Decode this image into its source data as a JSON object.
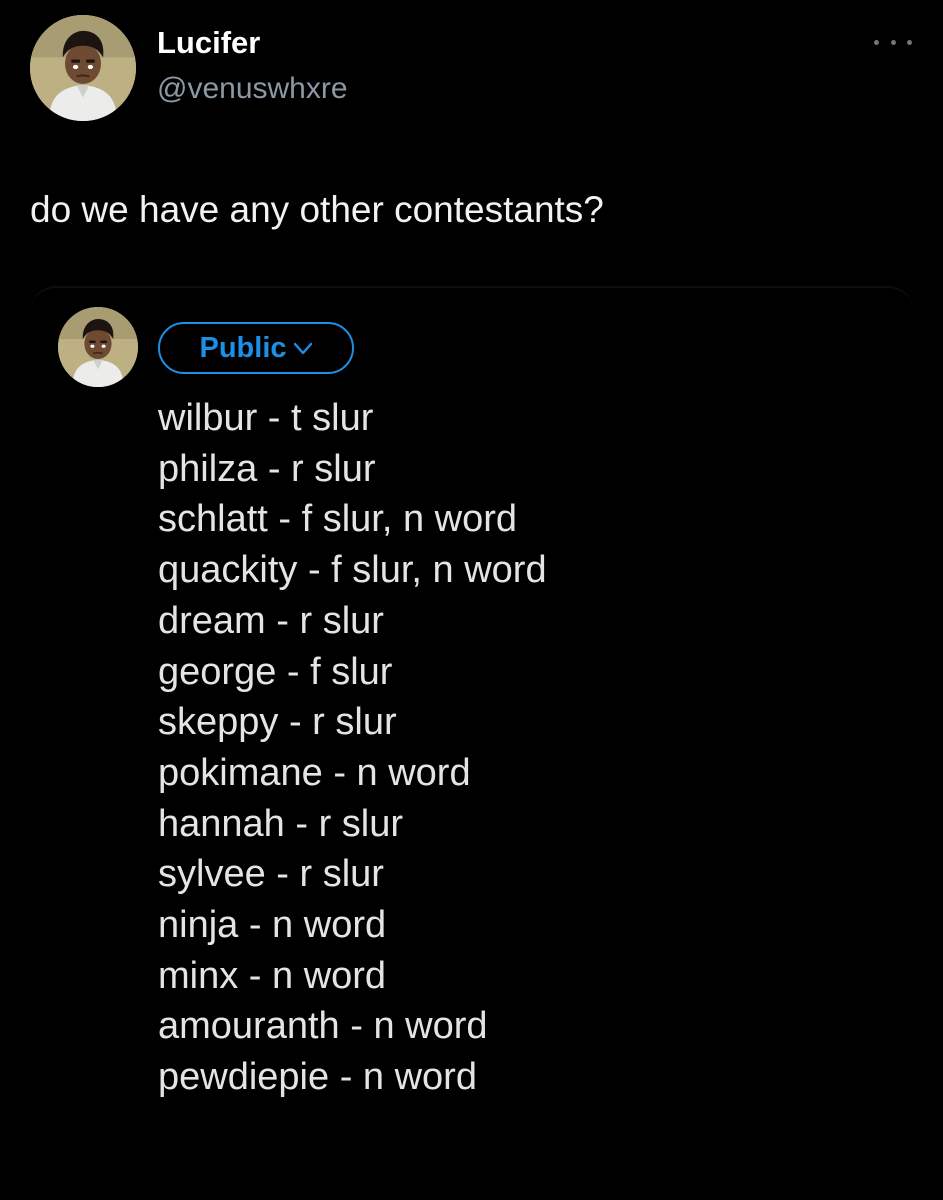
{
  "post": {
    "display_name": "Lucifer",
    "handle": "@venuswhxre",
    "text": "do we have any other contestants?",
    "more_icon": "more-horizontal-icon"
  },
  "quoted": {
    "audience_label": "Public",
    "audience_icon": "chevron-down-icon",
    "items": [
      "wilbur - t slur",
      "philza - r slur",
      "schlatt - f slur, n word",
      "quackity - f slur, n word",
      "dream - r slur",
      "george - f slur",
      "skeppy - r slur",
      "pokimane - n word",
      "hannah - r slur",
      "sylvee - r slur",
      "ninja - n word",
      "minx - n word",
      "amouranth - n word",
      "pewdiepie - n word"
    ]
  },
  "colors": {
    "background": "#000000",
    "primary_text": "#e7e9ea",
    "secondary_text": "#8b98a5",
    "accent": "#1d8fe6"
  }
}
